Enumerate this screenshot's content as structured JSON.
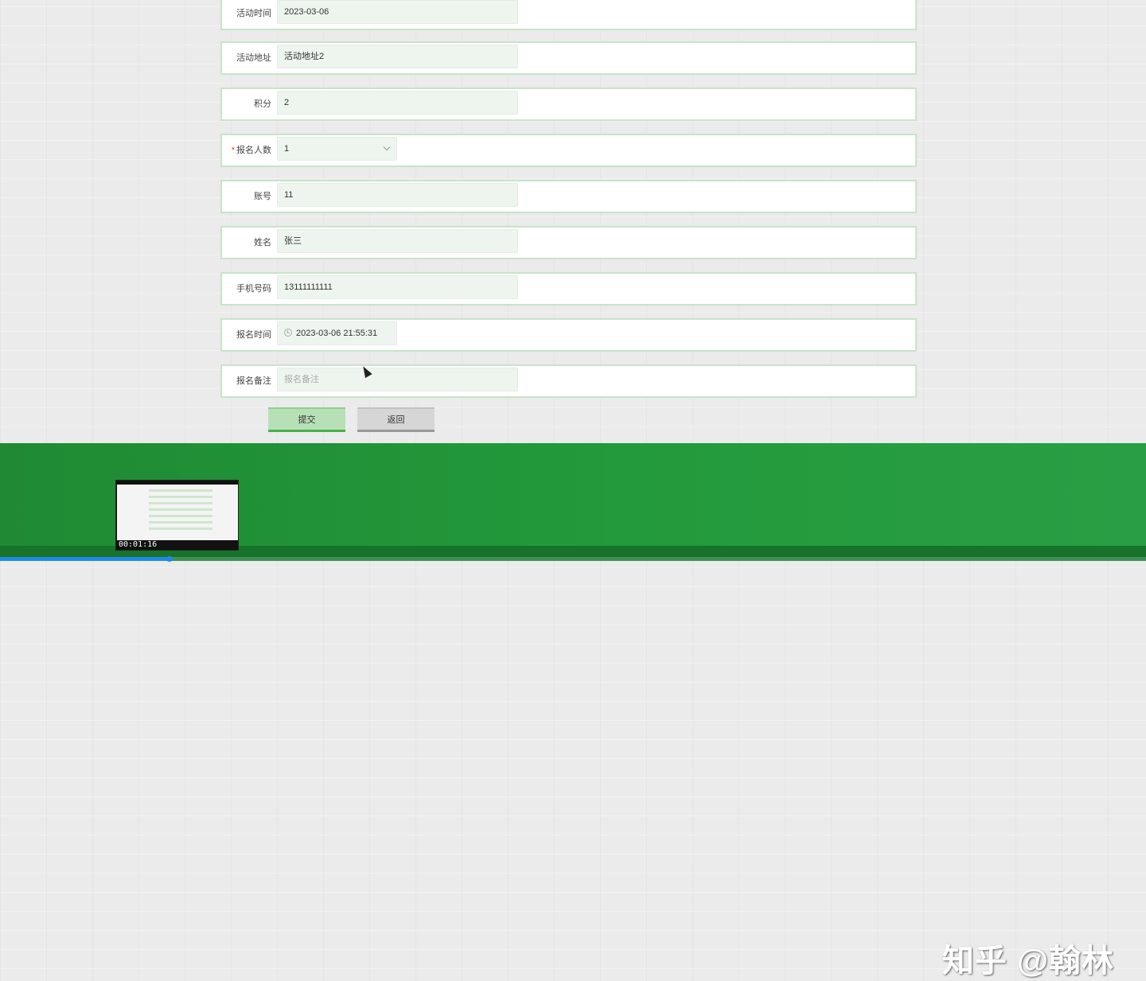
{
  "form": {
    "rows": [
      {
        "label": "活动时间",
        "value": "2023-03-06",
        "required": false
      },
      {
        "label": "活动地址",
        "value": "活动地址2",
        "required": false
      },
      {
        "label": "积分",
        "value": "2",
        "required": false
      },
      {
        "label": "报名人数",
        "value": "1",
        "required": true
      },
      {
        "label": "账号",
        "value": "11",
        "required": false
      },
      {
        "label": "姓名",
        "value": "张三",
        "required": false
      },
      {
        "label": "手机号码",
        "value": "13111111111",
        "required": false
      },
      {
        "label": "报名时间",
        "value": "2023-03-06 21:55:31",
        "required": false
      },
      {
        "label": "报名备注",
        "placeholder": "报名备注",
        "required": false
      }
    ],
    "required_mark": "*",
    "submit_label": "提交",
    "back_label": "返回"
  },
  "video": {
    "thumbnail_time": "00:01:16",
    "watermark": "知乎 @翰林",
    "progress": 0.149
  },
  "colors": {
    "accent_green": "#4caf50",
    "footer_green": "#239a3c",
    "progress_blue": "#1e88e5"
  },
  "icons": [
    "chevron-down-icon",
    "clock-icon",
    "cursor-icon"
  ]
}
